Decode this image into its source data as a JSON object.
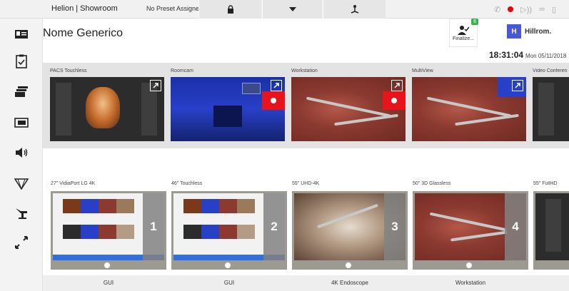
{
  "topbar": {
    "title": "Helion | Showroom",
    "preset": "No Preset Assigned"
  },
  "header": {
    "title": "Nome Generico",
    "finalize_label": "Finalize...",
    "finalize_badge": "6",
    "brand_logo": "H",
    "brand_name": "Hillrom.",
    "time": "18:31:04",
    "date": "Mon 05/11/2018"
  },
  "sidebar": {
    "items": [
      {
        "icon": "patient-card-icon"
      },
      {
        "icon": "checklist-icon"
      },
      {
        "icon": "sources-stack-icon"
      },
      {
        "icon": "display-layout-icon"
      },
      {
        "icon": "audio-icon"
      },
      {
        "icon": "surgical-light-icon"
      },
      {
        "icon": "surgical-table-icon"
      },
      {
        "icon": "camera-control-icon"
      }
    ]
  },
  "sources": [
    {
      "label": "PACS Touchless",
      "recording": false
    },
    {
      "label": "Roomcam",
      "recording": true
    },
    {
      "label": "Workstation",
      "recording": true
    },
    {
      "label": "MultiView",
      "recording": false
    },
    {
      "label": "Video Conferen",
      "recording": false
    }
  ],
  "displays": [
    {
      "label": "27\" VidiaPort LG 4K",
      "number": "1",
      "content": "GUI"
    },
    {
      "label": "46\" Touchless",
      "number": "2",
      "content": "GUI"
    },
    {
      "label": "55\" UHD-4K",
      "number": "3",
      "content": "4K Endoscope"
    },
    {
      "label": "50\" 3D Glassless",
      "number": "4",
      "content": "Workstation"
    },
    {
      "label": "55\" FullHD",
      "number": "",
      "content": ""
    }
  ],
  "colors": {
    "record": "#e8141b",
    "brand": "#4a5ad6",
    "badge": "#3cb24a"
  }
}
